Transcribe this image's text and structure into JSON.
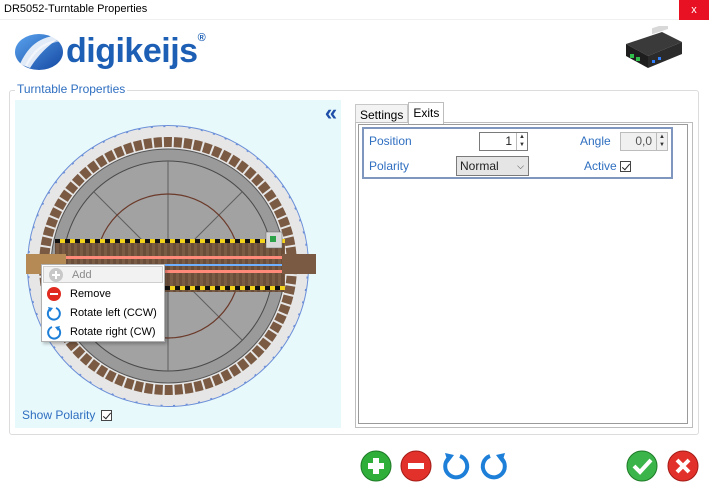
{
  "window": {
    "title": "DR5052-Turntable Properties",
    "close_label": "x"
  },
  "brand": {
    "name": "digikeijs",
    "registered": "®"
  },
  "group": {
    "legend": "Turntable Properties"
  },
  "left": {
    "collapse_glyph": "«",
    "show_polarity_label": "Show Polarity",
    "show_polarity_checked": true
  },
  "context_menu": {
    "items": [
      {
        "label": "Add",
        "icon": "add-icon",
        "disabled": true
      },
      {
        "label": "Remove",
        "icon": "remove-icon",
        "disabled": false
      },
      {
        "label": "Rotate left (CCW)",
        "icon": "rotate-left-icon",
        "disabled": false
      },
      {
        "label": "Rotate right (CW)",
        "icon": "rotate-right-icon",
        "disabled": false
      }
    ]
  },
  "tabs": [
    {
      "label": "Settings",
      "active": false
    },
    {
      "label": "Exits",
      "active": true
    }
  ],
  "exits": {
    "position_label": "Position",
    "position_value": "1",
    "angle_label": "Angle",
    "angle_value": "0,0",
    "polarity_label": "Polarity",
    "polarity_value": "Normal",
    "active_label": "Active",
    "active_checked": true
  },
  "toolbar": {
    "icons": [
      "add-icon",
      "remove-icon",
      "rotate-left-icon",
      "rotate-right-icon",
      "ok-icon",
      "cancel-icon"
    ]
  },
  "colors": {
    "brand_blue": "#1c5fb5",
    "label_blue": "#2f6fc0",
    "close_red": "#e81123",
    "panel_bg": "#e8f9fc"
  }
}
